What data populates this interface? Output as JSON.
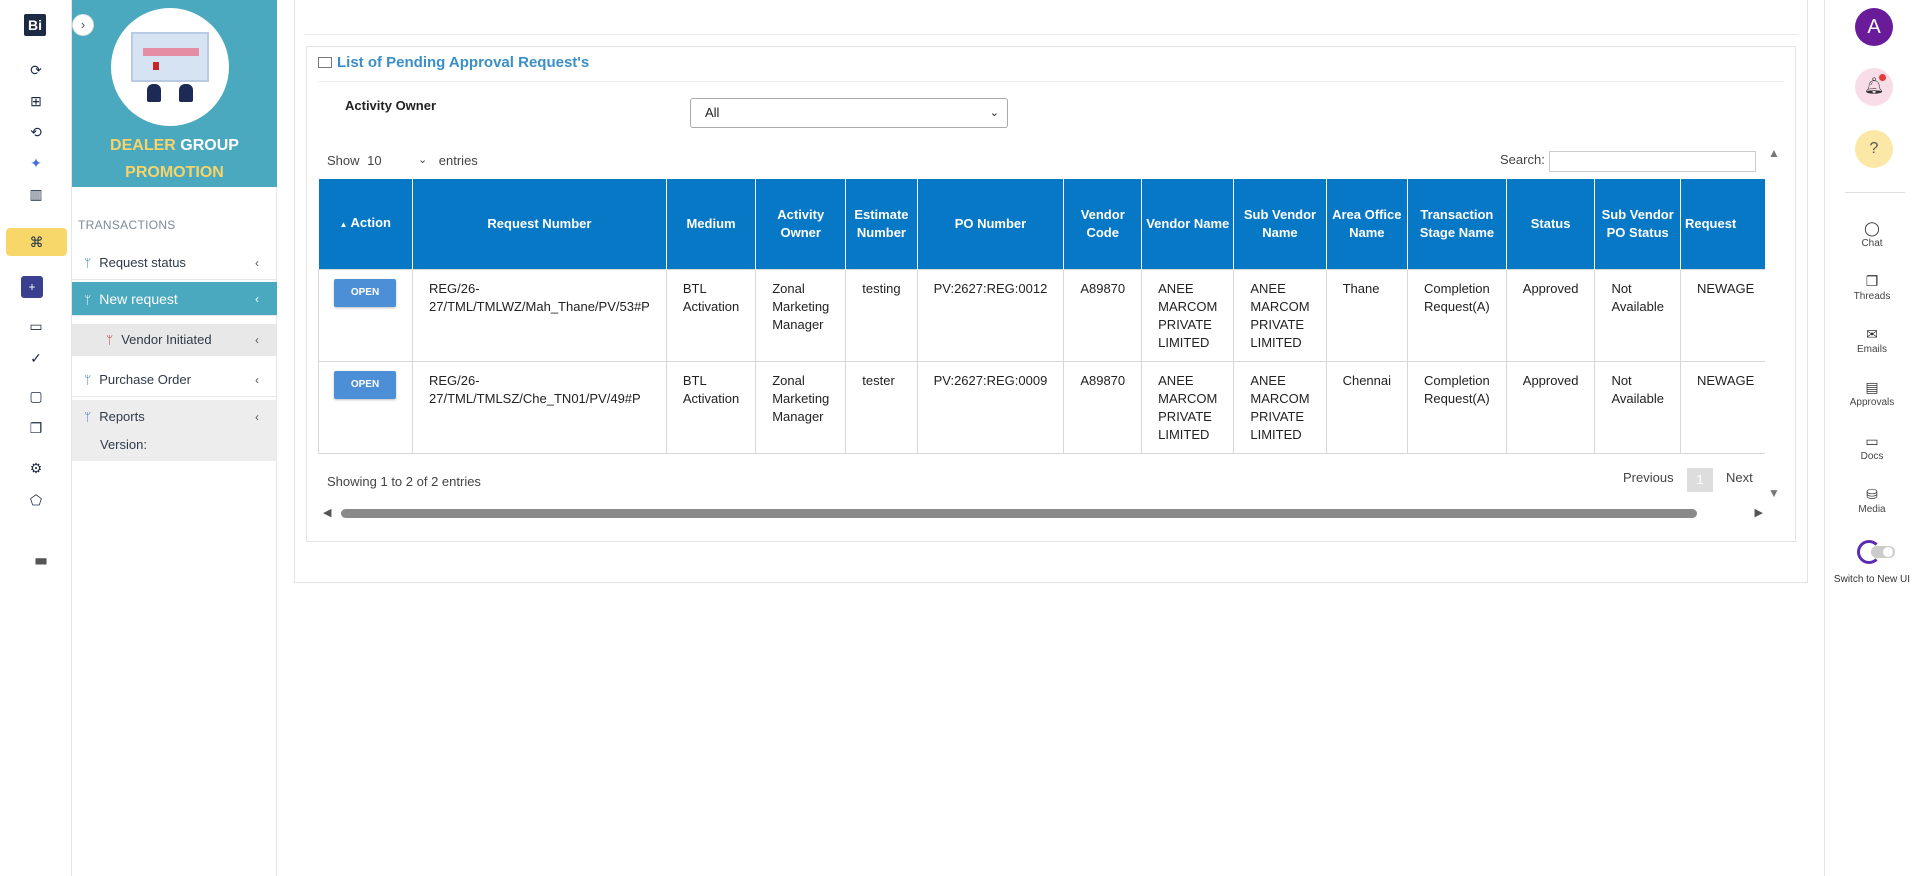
{
  "app": {
    "logo_text": "Bi"
  },
  "banner": {
    "title_part1": "DEALER",
    "title_part2": "GROUP",
    "title_part3": "PROMOTION"
  },
  "sidebar": {
    "section": "TRANSACTIONS",
    "items": [
      {
        "label": "Request status"
      },
      {
        "label": "New request"
      },
      {
        "label": "Vendor Initiated"
      },
      {
        "label": "Purchase Order"
      },
      {
        "label": "Reports"
      }
    ],
    "version_label": "Version:"
  },
  "page": {
    "title": "List of Pending Approval Request's",
    "filter_label": "Activity Owner",
    "filter_value": "All",
    "show_label": "Show",
    "entries_value": "10",
    "entries_label": "entries",
    "search_label": "Search:",
    "info": "Showing 1 to 2 of 2 entries",
    "prev": "Previous",
    "page_num": "1",
    "next": "Next"
  },
  "table": {
    "columns": [
      "Action",
      "Request Number",
      "Medium",
      "Activity Owner",
      "Estimate Number",
      "PO Number",
      "Vendor Code",
      "Vendor Name",
      "Sub Vendor Name",
      "Area Office Name",
      "Transaction Stage Name",
      "Status",
      "Sub Vendor PO Status",
      "Request"
    ],
    "sort_indicator": "▲",
    "open_label": "OPEN",
    "rows": [
      {
        "request_number": "REG/26-27/TML/TMLWZ/Mah_Thane/PV/53#P",
        "medium": "BTL Activation",
        "activity_owner": "Zonal Marketing Manager",
        "estimate_number": "testing",
        "po_number": "PV:2627:REG:0012",
        "vendor_code": "A89870",
        "vendor_name": "ANEE MARCOM PRIVATE LIMITED",
        "sub_vendor_name": "ANEE MARCOM PRIVATE LIMITED",
        "area_office": "Thane",
        "stage": "Completion Request(A)",
        "status": "Approved",
        "sub_vendor_po_status": "Not Available",
        "request": "NEWAGE"
      },
      {
        "request_number": "REG/26-27/TML/TMLSZ/Che_TN01/PV/49#P",
        "medium": "BTL Activation",
        "activity_owner": "Zonal Marketing Manager",
        "estimate_number": "tester",
        "po_number": "PV:2627:REG:0009",
        "vendor_code": "A89870",
        "vendor_name": "ANEE MARCOM PRIVATE LIMITED",
        "sub_vendor_name": "ANEE MARCOM PRIVATE LIMITED",
        "area_office": "Chennai",
        "stage": "Completion Request(A)",
        "status": "Approved",
        "sub_vendor_po_status": "Not Available",
        "request": "NEWAGE"
      }
    ]
  },
  "right_rail": {
    "avatar_initial": "A",
    "items": [
      {
        "label": "Chat"
      },
      {
        "label": "Threads"
      },
      {
        "label": "Emails"
      },
      {
        "label": "Approvals"
      },
      {
        "label": "Docs"
      },
      {
        "label": "Media"
      }
    ],
    "toggle_label": "Switch to New UI"
  },
  "colors": {
    "primary_header": "#0778c6",
    "sidebar_teal": "#4aa9be",
    "active_yellow": "#f7d76a",
    "open_button": "#4d8fd6"
  }
}
